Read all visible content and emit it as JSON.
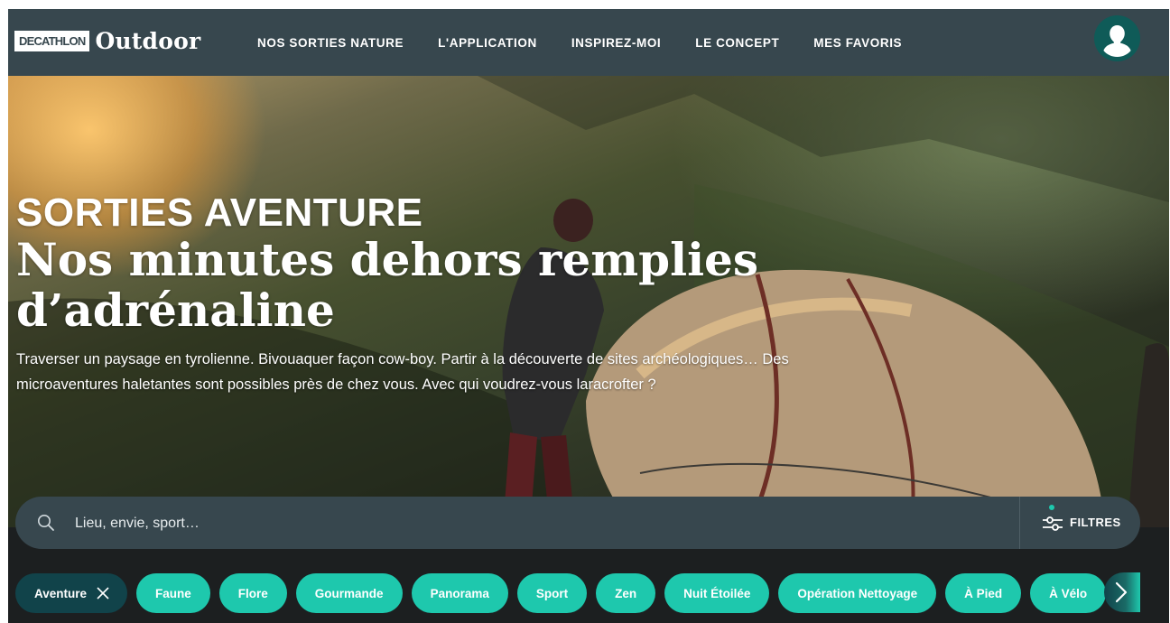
{
  "brand": {
    "box_text": "DECATHLON",
    "word": "Outdoor"
  },
  "nav": {
    "items": [
      {
        "label": "NOS SORTIES NATURE"
      },
      {
        "label": "L'APPLICATION"
      },
      {
        "label": "INSPIREZ-MOI"
      },
      {
        "label": "LE CONCEPT"
      },
      {
        "label": "MES FAVORIS"
      }
    ],
    "avatar_icon": "user-silhouette-icon"
  },
  "hero": {
    "kicker": "SORTIES AVENTURE",
    "headline": "Nos minutes dehors remplies d’adrénaline",
    "intro": "Traverser un paysage en tyrolienne. Bivouaquer façon cow-boy. Partir à la découverte de sites archéologiques… Des microaventures haletantes sont possibles près de chez vous. Avec qui voudrez-vous laracrofter ?"
  },
  "search": {
    "icon": "search-icon",
    "placeholder": "Lieu, envie, sport…",
    "filters_label": "FILTRES",
    "filters_icon": "sliders-icon"
  },
  "tags": {
    "active": {
      "label": "Aventure",
      "close_icon": "close-icon"
    },
    "items": [
      {
        "label": "Faune"
      },
      {
        "label": "Flore"
      },
      {
        "label": "Gourmande"
      },
      {
        "label": "Panorama"
      },
      {
        "label": "Sport"
      },
      {
        "label": "Zen"
      },
      {
        "label": "Nuit Étoilée"
      },
      {
        "label": "Opération Nettoyage"
      },
      {
        "label": "À Pied"
      },
      {
        "label": "À Vélo"
      }
    ],
    "next_icon": "chevron-right-icon"
  },
  "colors": {
    "header_bg": "#37474e",
    "accent_teal": "#1ec8ad",
    "active_tag": "#11434a",
    "avatar_bg": "#0f5b58"
  }
}
